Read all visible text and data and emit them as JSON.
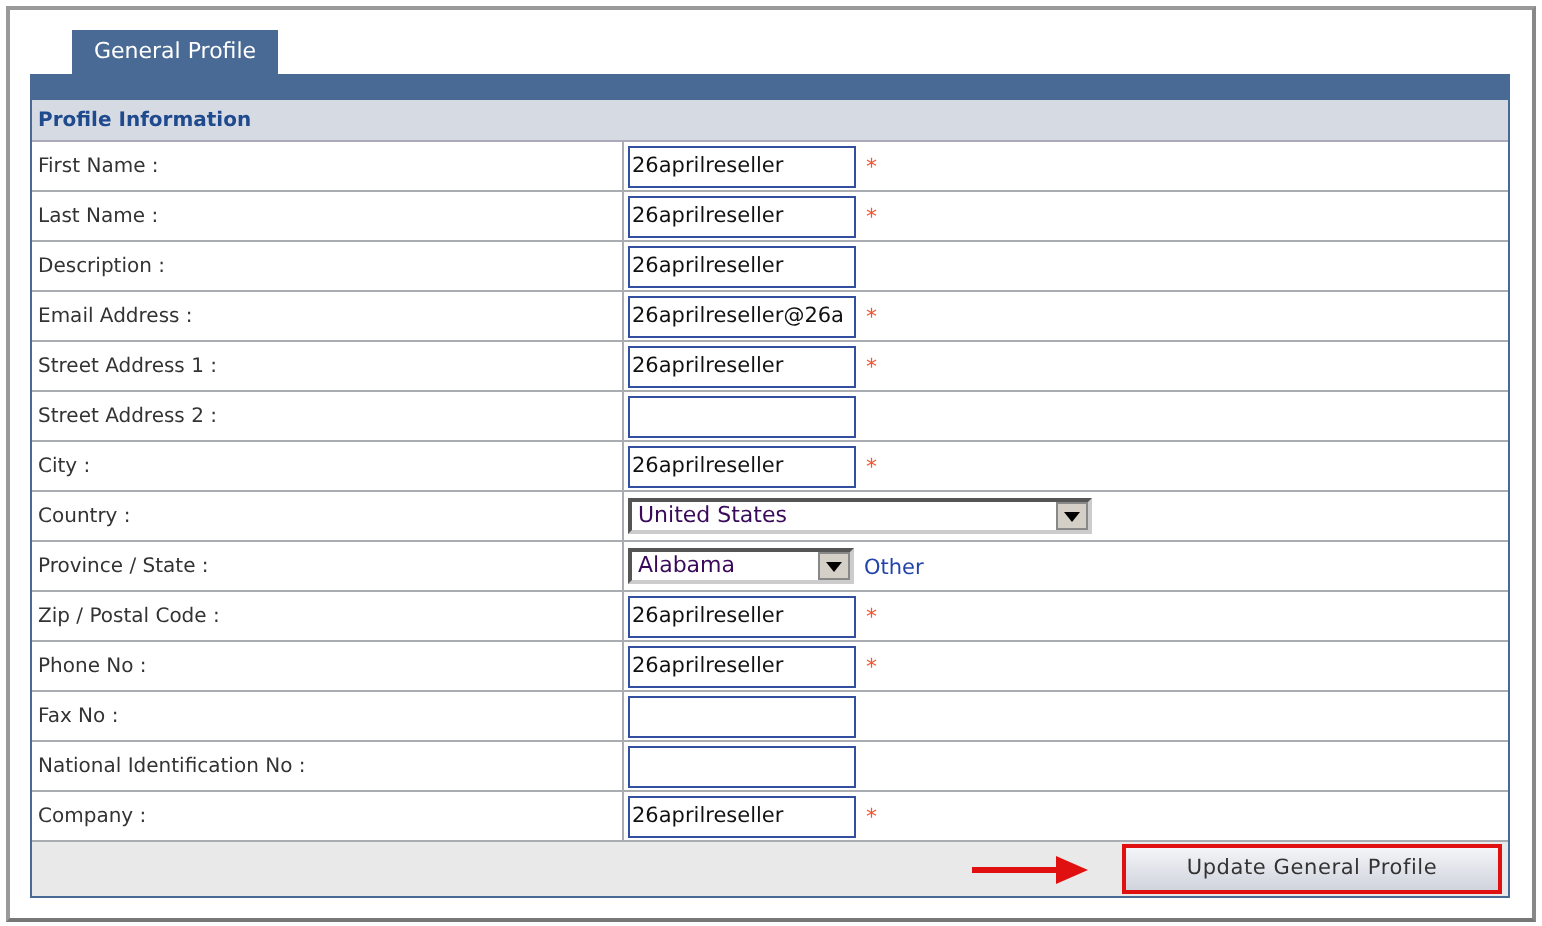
{
  "tabs": [
    {
      "label": "General Profile",
      "selected": true
    }
  ],
  "section_title": "Profile Information",
  "fields": [
    {
      "kind": "text",
      "label": "First Name :",
      "value": "26aprilreseller",
      "required_mark": "*"
    },
    {
      "kind": "text",
      "label": "Last Name :",
      "value": "26aprilreseller",
      "required_mark": "*"
    },
    {
      "kind": "text",
      "label": "Description :",
      "value": "26aprilreseller"
    },
    {
      "kind": "text",
      "label": "Email Address :",
      "value": "26aprilreseller@26a",
      "required_mark": "*"
    },
    {
      "kind": "text",
      "label": "Street Address 1 :",
      "value": "26aprilreseller",
      "required_mark": "*"
    },
    {
      "kind": "text",
      "label": "Street Address 2 :"
    },
    {
      "kind": "text",
      "label": "City :",
      "value": "26aprilreseller",
      "required_mark": "*"
    },
    {
      "kind": "select",
      "label": "Country :",
      "value": "United States"
    },
    {
      "kind": "select_short",
      "label": "Province / State :",
      "value": "Alabama",
      "link": "Other"
    },
    {
      "kind": "text",
      "label": "Zip / Postal Code :",
      "value": "26aprilreseller",
      "required_mark": "*"
    },
    {
      "kind": "text",
      "label": "Phone No :",
      "value": "26aprilreseller",
      "required_mark": "*"
    },
    {
      "kind": "text",
      "label": "Fax No :"
    },
    {
      "kind": "text",
      "label": "National Identification No :"
    },
    {
      "kind": "text",
      "label": "Company :",
      "value": "26aprilreseller",
      "required_mark": "*"
    }
  ],
  "submit_button": "Update General Profile"
}
